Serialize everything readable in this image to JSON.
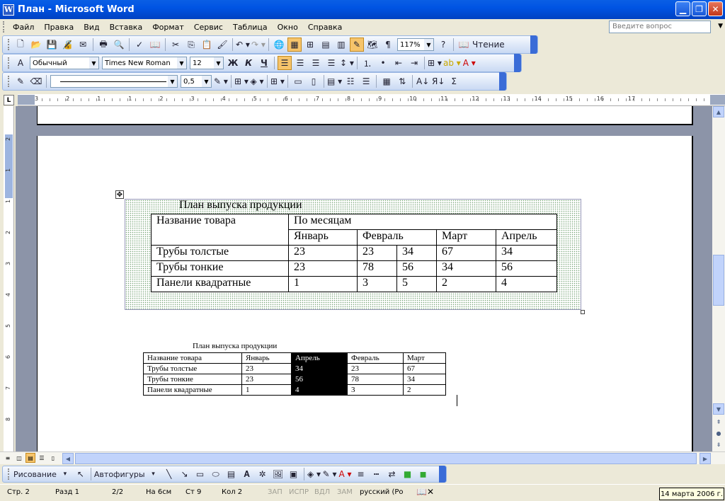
{
  "window": {
    "title": "План - Microsoft Word",
    "icon_letter": "W"
  },
  "menu": {
    "items": [
      "Файл",
      "Правка",
      "Вид",
      "Вставка",
      "Формат",
      "Сервис",
      "Таблица",
      "Окно",
      "Справка"
    ],
    "help_placeholder": "Введите вопрос"
  },
  "standard_toolbar": {
    "zoom": "117%",
    "reading_label": "Чтение"
  },
  "format_toolbar": {
    "style": "Обычный",
    "font": "Times New Roman",
    "size": "12",
    "bold": "Ж",
    "italic": "К",
    "underline": "Ч"
  },
  "table_toolbar": {
    "line_weight": "0,5"
  },
  "ruler": {
    "numbers": [
      "3",
      "2",
      "1",
      "1",
      "2",
      "3",
      "4",
      "5",
      "6",
      "7",
      "8",
      "9",
      "10",
      "11",
      "12",
      "13",
      "14",
      "15",
      "16",
      "17"
    ]
  },
  "document": {
    "big_table_title": "План выпуска продукции",
    "big_table": {
      "header1": [
        "Название товара",
        "По месяцам"
      ],
      "header2": [
        "Январь",
        "Февраль",
        "Март",
        "Апрель"
      ],
      "rows": [
        [
          "Трубы толстые",
          "23",
          "23",
          "34",
          "67",
          "34"
        ],
        [
          "Трубы тонкие",
          "23",
          "78",
          "56",
          "34",
          "56"
        ],
        [
          "Панели квадратные",
          "1",
          "3",
          "5",
          "2",
          "4"
        ]
      ]
    },
    "small_table_title": "План выпуска продукции",
    "small_table": {
      "header": [
        "Название товара",
        "Январь",
        "Апрель",
        "Февраль",
        "Март"
      ],
      "rows": [
        [
          "Трубы толстые",
          "23",
          "34",
          "23",
          "67"
        ],
        [
          "Трубы тонкие",
          "23",
          "56",
          "78",
          "34"
        ],
        [
          "Панели квадратные",
          "1",
          "4",
          "3",
          "2"
        ]
      ]
    }
  },
  "drawing_toolbar": {
    "draw_label": "Рисование",
    "autoshapes_label": "Автофигуры"
  },
  "status": {
    "page": "Стр. 2",
    "section": "Разд 1",
    "pages": "2/2",
    "position": "На 6см",
    "line": "Ст 9",
    "column": "Кол 2",
    "rec": "ЗАП",
    "trk": "ИСПР",
    "ext": "ВДЛ",
    "ovr": "ЗАМ",
    "language": "русский (Ро"
  },
  "tray": {
    "date": "14 марта 2006 г."
  }
}
